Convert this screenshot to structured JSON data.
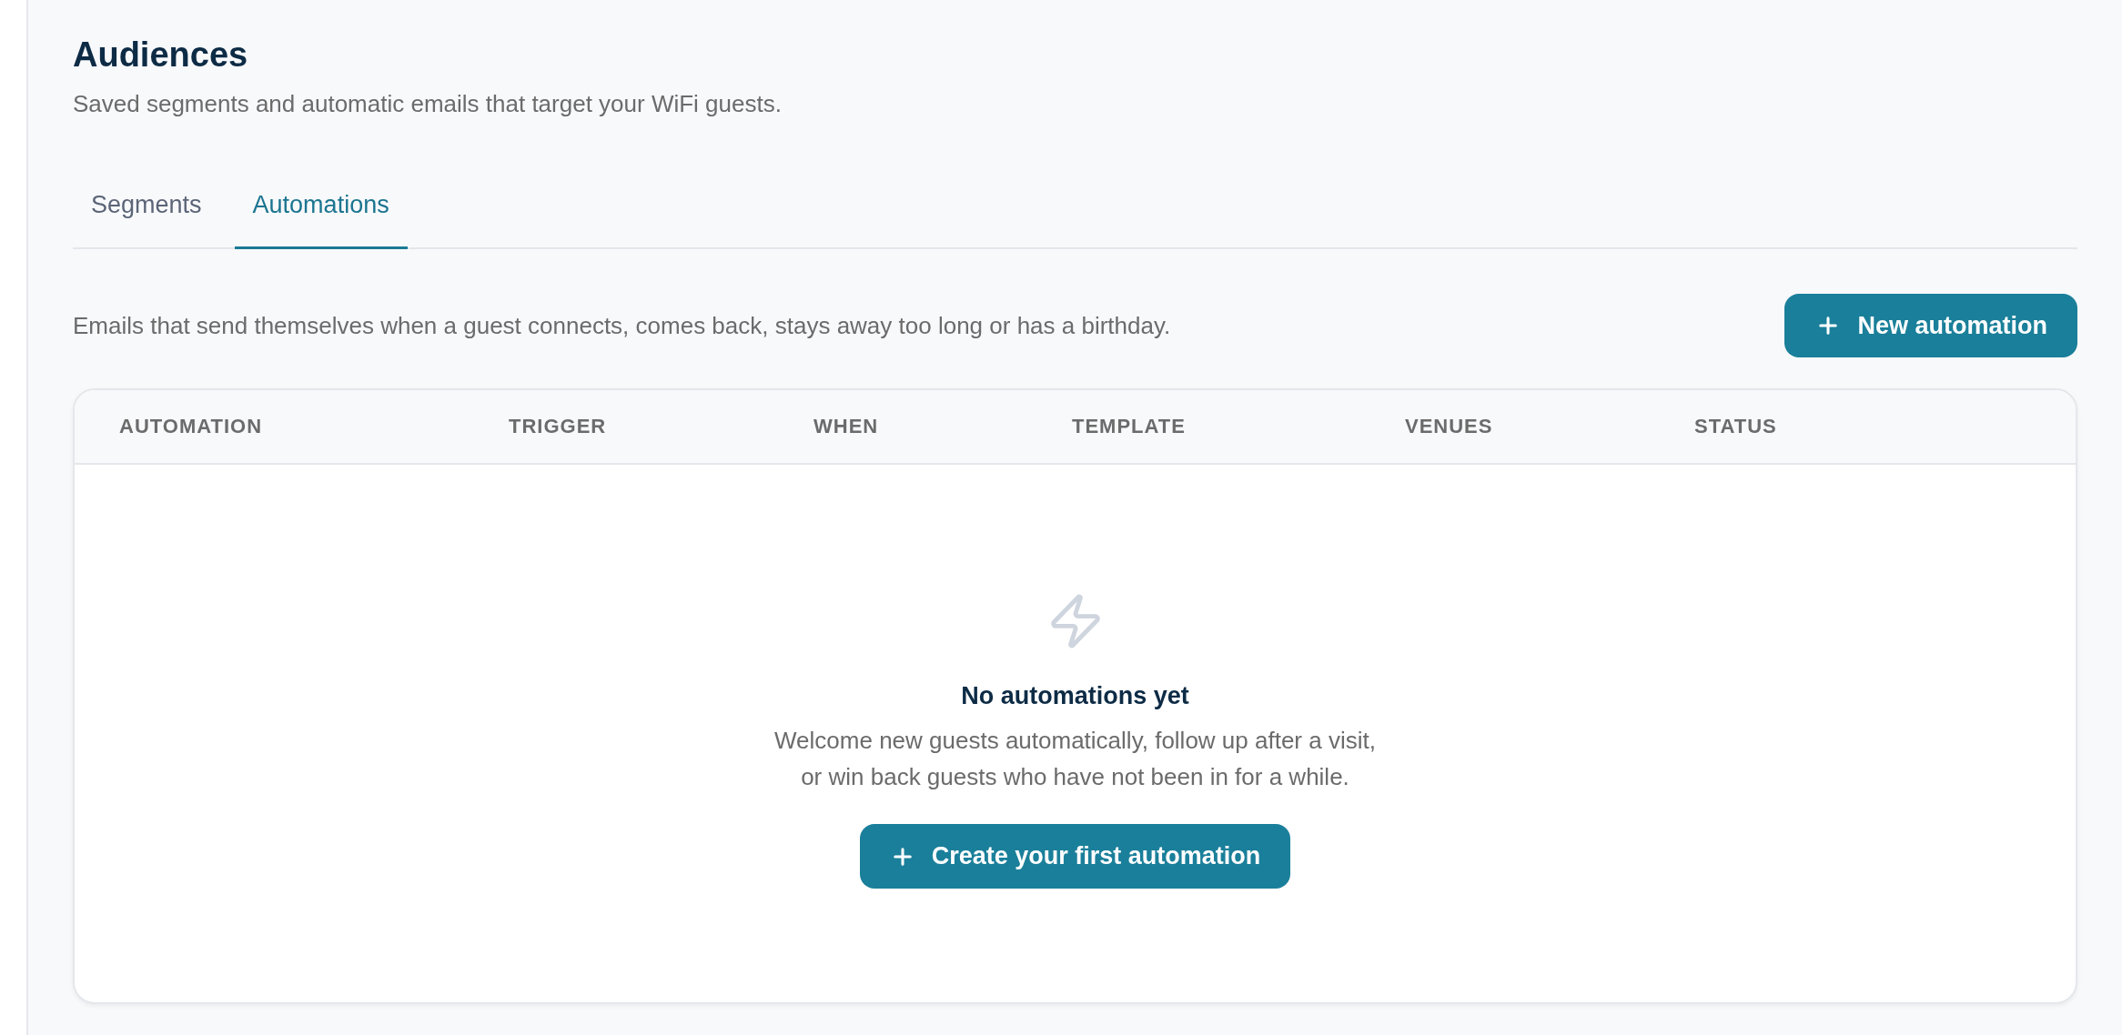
{
  "header": {
    "title": "Audiences",
    "subtitle": "Saved segments and automatic emails that target your WiFi guests."
  },
  "tabs": [
    {
      "label": "Segments",
      "selected": false
    },
    {
      "label": "Automations",
      "selected": true
    }
  ],
  "toolbar": {
    "description": "Emails that send themselves when a guest connects, comes back, stays away too long or has a birthday.",
    "button": "New automation"
  },
  "table": {
    "columns": [
      "AUTOMATION",
      "TRIGGER",
      "WHEN",
      "TEMPLATE",
      "VENUES",
      "STATUS"
    ],
    "empty_state": {
      "title": "No automations yet",
      "description_lines": [
        "Welcome new guests automatically, follow up after a visit,",
        "or win back guests who have not been in for a while."
      ],
      "button": "Create your first automation"
    }
  }
}
